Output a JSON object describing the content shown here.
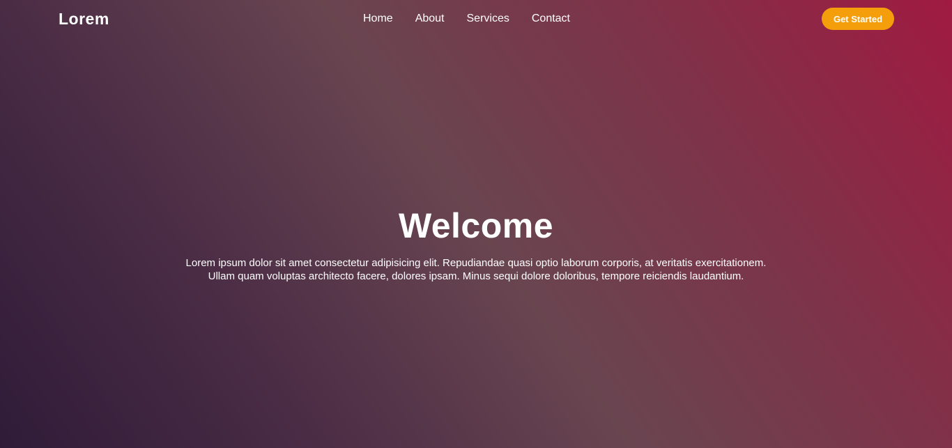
{
  "header": {
    "logo": "Lorem",
    "nav": [
      {
        "label": "Home"
      },
      {
        "label": "About"
      },
      {
        "label": "Services"
      },
      {
        "label": "Contact"
      }
    ],
    "cta_label": "Get Started"
  },
  "hero": {
    "title": "Welcome",
    "text_line1": "Lorem ipsum dolor sit amet consectetur adipisicing elit. Repudiandae quasi optio laborum corporis, at veritatis exercitationem.",
    "text_line2": "Ullam quam voluptas architecto facere, dolores ipsam. Minus sequi dolore doloribus, tempore reiciendis laudantium."
  },
  "colors": {
    "accent": "#f59e0b",
    "gradient_start": "#2f1b38",
    "gradient_end": "#a01a41",
    "text": "#ffffff"
  }
}
